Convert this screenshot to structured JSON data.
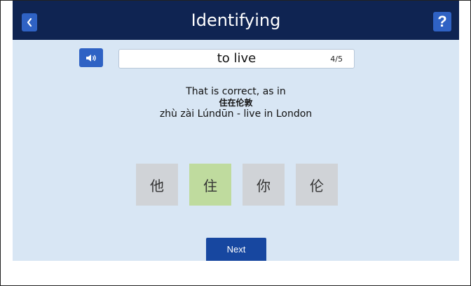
{
  "header": {
    "title": "Identifying",
    "back_icon": "chevron-left-icon",
    "help_label": "?"
  },
  "prompt": {
    "sound_icon": "speaker-icon",
    "word": "to live",
    "progress": "4/5"
  },
  "feedback": {
    "line1": "That is correct, as in",
    "line2": "住在伦敦",
    "line3": "zhù zài Lúndūn - live in London"
  },
  "choices": [
    {
      "char": "他",
      "state": "neutral"
    },
    {
      "char": "住",
      "state": "correct"
    },
    {
      "char": "你",
      "state": "neutral"
    },
    {
      "char": "伦",
      "state": "neutral"
    }
  ],
  "next_label": "Next",
  "colors": {
    "header_bg": "#0f2452",
    "button_blue": "#2f62c4",
    "app_bg": "#d8e6f4",
    "correct_bg": "#bfdb9e",
    "choice_bg": "#d0d3d7",
    "next_bg": "#1747a0"
  }
}
